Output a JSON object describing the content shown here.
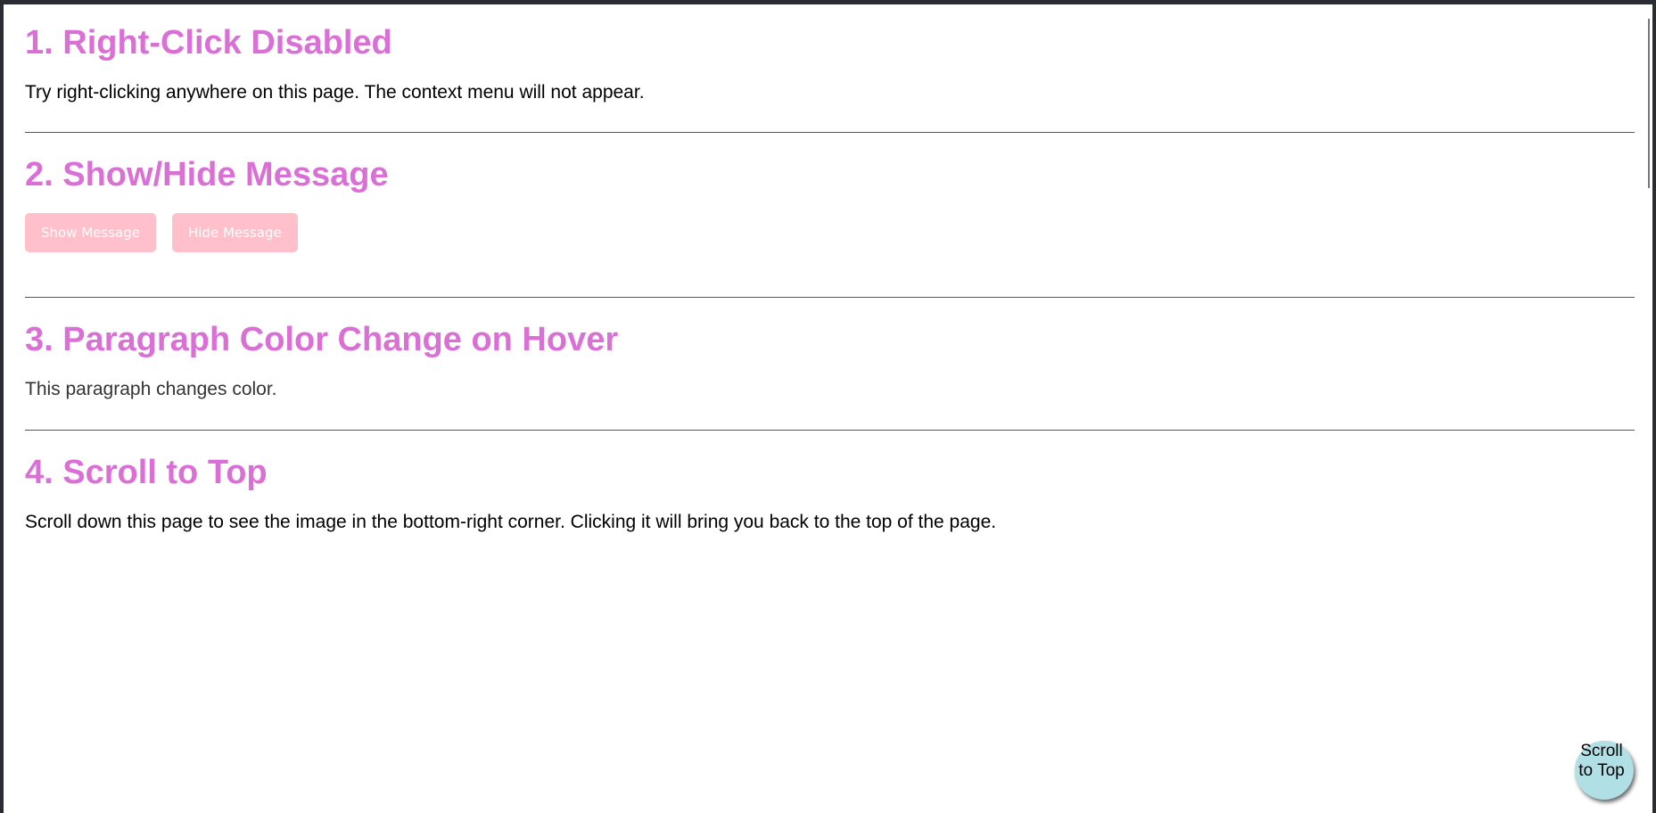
{
  "sections": [
    {
      "title": "1. Right-Click Disabled",
      "text": "Try right-clicking anywhere on this page. The context menu will not appear."
    },
    {
      "title": "2. Show/Hide Message",
      "buttons": {
        "show": "Show Message",
        "hide": "Hide Message"
      }
    },
    {
      "title": "3. Paragraph Color Change on Hover",
      "text": "This paragraph changes color."
    },
    {
      "title": "4. Scroll to Top",
      "text": "Scroll down this page to see the image in the bottom-right corner. Clicking it will bring you back to the top of the page."
    }
  ],
  "scroll_to_top": {
    "label": "Scroll to Top"
  },
  "colors": {
    "heading": "#da70d6",
    "button_bg": "#ffc0cb",
    "button_text": "#ffffff",
    "scroll_button_bg": "#b0e0e6"
  }
}
